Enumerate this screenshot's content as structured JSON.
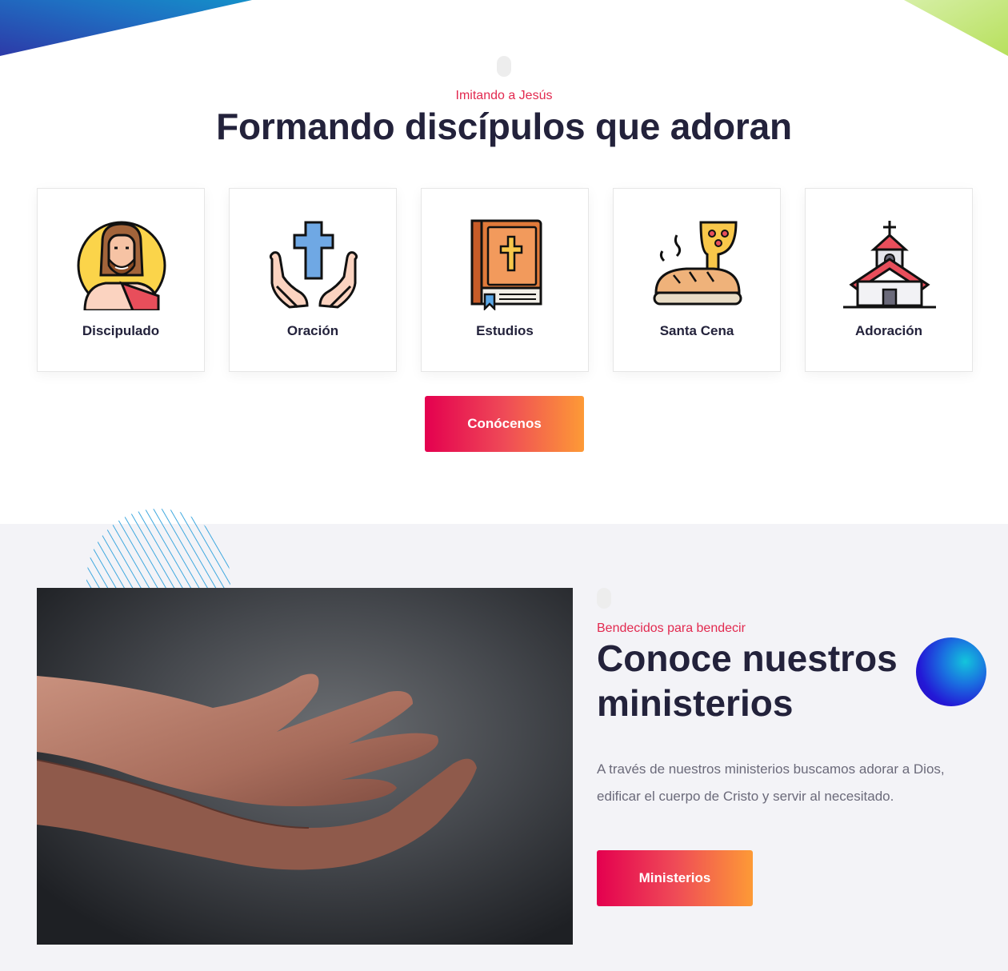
{
  "hero": {
    "eyebrow": "Imitando a Jesús",
    "title": "Formando discípulos que adoran"
  },
  "features": [
    {
      "label": "Discipulado",
      "icon": "jesus-icon"
    },
    {
      "label": "Oración",
      "icon": "praying-hands-cross-icon"
    },
    {
      "label": "Estudios",
      "icon": "bible-icon"
    },
    {
      "label": "Santa Cena",
      "icon": "bread-chalice-icon"
    },
    {
      "label": "Adoración",
      "icon": "church-icon"
    }
  ],
  "cta_primary": "Conócenos",
  "ministries": {
    "eyebrow": "Bendecidos para bendecir",
    "title": "Conoce nuestros ministerios",
    "description": "A través de nuestros ministerios buscamos adorar a Dios, edificar el cuerpo de Cristo y servir al necesitado.",
    "button": "Ministerios",
    "image_alt": "open-hands-photo"
  },
  "colors": {
    "accent": "#e2294f",
    "gradient_start": "#e4004f",
    "gradient_end": "#fd9a36",
    "heading": "#23223b",
    "section_bg": "#f3f3f7"
  }
}
